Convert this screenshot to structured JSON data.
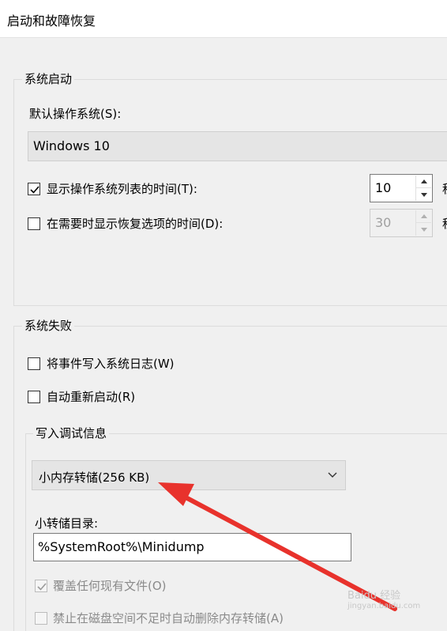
{
  "window": {
    "title": "启动和故障恢复"
  },
  "system_startup": {
    "group_label": "系统启动",
    "default_os_label": "默认操作系统(S):",
    "default_os_value": "Windows 10",
    "show_os_list": {
      "checked": true,
      "label": "显示操作系统列表的时间(T):",
      "value": "10",
      "suffix": "秒"
    },
    "show_recovery": {
      "checked": false,
      "label": "在需要时显示恢复选项的时间(D):",
      "value": "30",
      "suffix": "秒"
    }
  },
  "system_failure": {
    "group_label": "系统失败",
    "write_event_log": {
      "checked": false,
      "label": "将事件写入系统日志(W)"
    },
    "auto_restart": {
      "checked": false,
      "label": "自动重新启动(R)"
    },
    "debug_info": {
      "group_label": "写入调试信息",
      "dump_type": "小内存转储(256 KB)",
      "dump_dir_label": "小转储目录:",
      "dump_dir_value": "%SystemRoot%\\Minidump",
      "overwrite": {
        "checked": true,
        "disabled": true,
        "label": "覆盖任何现有文件(O)"
      },
      "disable_autodelete": {
        "checked": false,
        "disabled": true,
        "label": "禁止在磁盘空间不足时自动删除内存转储(A)"
      }
    }
  },
  "annotation": {
    "arrow_color": "#e8322c"
  },
  "watermark": {
    "text": "Baidu 经验",
    "url": "jingyan.baidu.com"
  }
}
